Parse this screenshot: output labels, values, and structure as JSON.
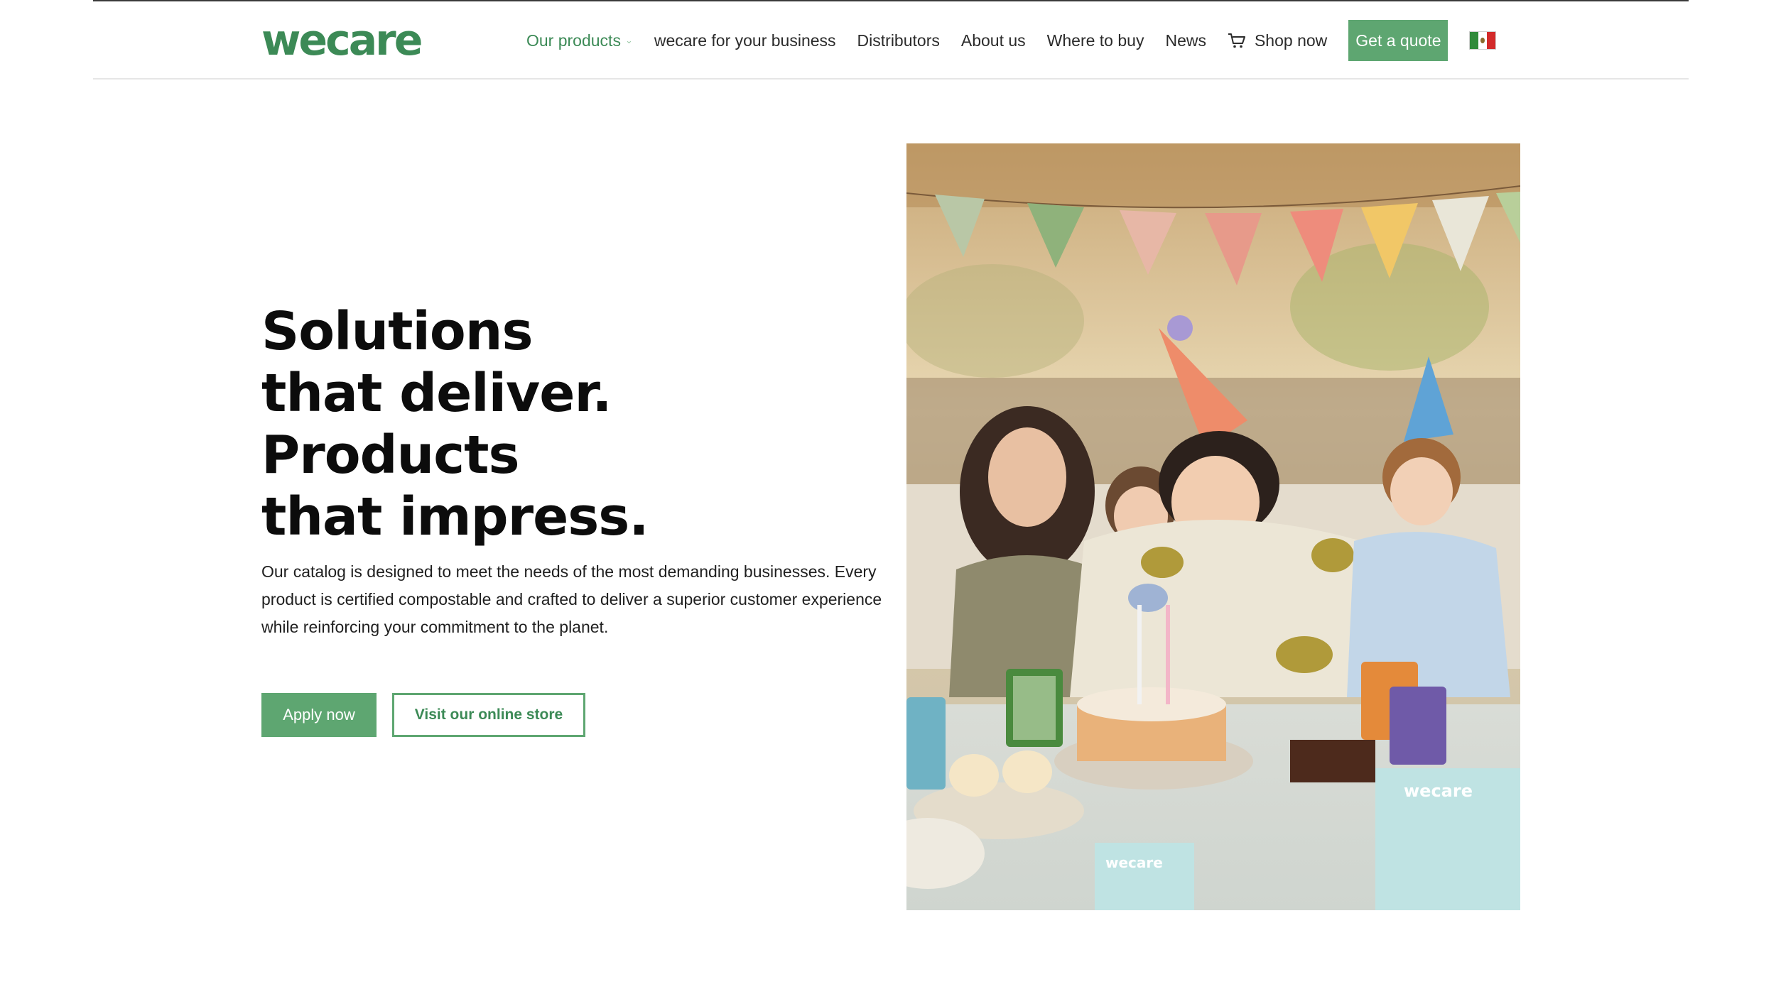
{
  "brand": {
    "logo_text": "wecare",
    "accent": "#5ea671",
    "logo_color": "#3c8a56"
  },
  "nav": {
    "items": [
      {
        "label": "Our products",
        "active": true,
        "dropdown": true
      },
      {
        "label": "wecare for your business"
      },
      {
        "label": "Distributors"
      },
      {
        "label": "About us"
      },
      {
        "label": "Where to buy"
      },
      {
        "label": "News"
      },
      {
        "label": "Shop now",
        "icon": "cart-icon"
      }
    ],
    "quote_label": "Get a quote",
    "language_flag": "mexico-flag-icon"
  },
  "hero": {
    "headline": [
      "Solutions",
      "that deliver.",
      "Products",
      "that impress."
    ],
    "description": "Our catalog is designed to meet the needs of the most demanding businesses. Every product is certified compostable and crafted to deliver a superior customer experience while reinforcing your commitment to the planet.",
    "apply_label": "Apply now",
    "store_label": "Visit our online store",
    "photo": "birthday-party-photo",
    "photo_wordmark": "wecare"
  }
}
